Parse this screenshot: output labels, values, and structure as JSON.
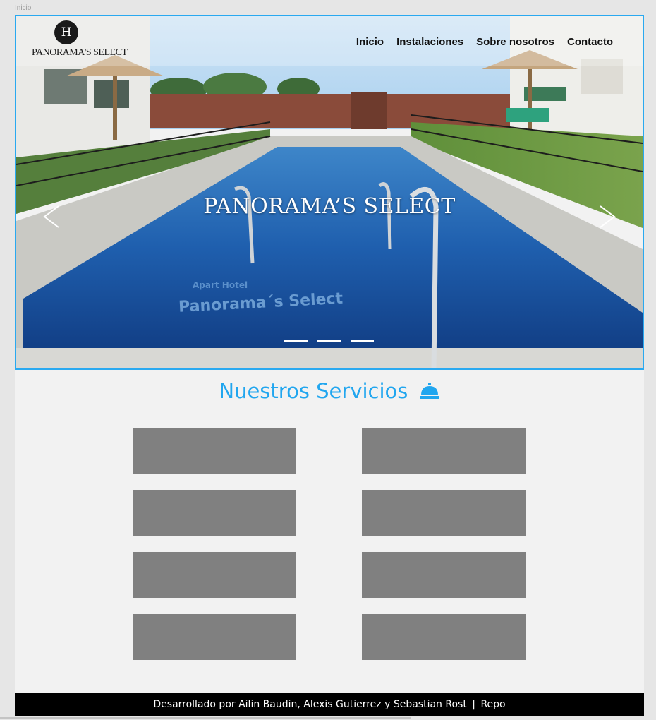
{
  "artboard_label": "Inicio",
  "brand": {
    "badge": "H",
    "name": "PANORAMA'S SELECT"
  },
  "nav": {
    "items": [
      "Inicio",
      "Instalaciones",
      "Sobre nosotros",
      "Contacto"
    ]
  },
  "hero": {
    "title": "PANORAMA’S SELECT",
    "pool_text_line1": "Apart Hotel",
    "pool_text_line2": "Panorama´s Select",
    "slide_count": 3
  },
  "services": {
    "title": "Nuestros Servicios",
    "icon": "concierge-bell-icon",
    "card_count": 8
  },
  "footer": {
    "credits": "Desarrollado por Ailin Baudin, Alexis Gutierrez y Sebastian Rost",
    "separator": "|",
    "repo_link": "Repo"
  },
  "colors": {
    "accent": "#21a6ef",
    "card": "#808080",
    "footer_bg": "#000000",
    "page_bg": "#f2f2f2"
  }
}
